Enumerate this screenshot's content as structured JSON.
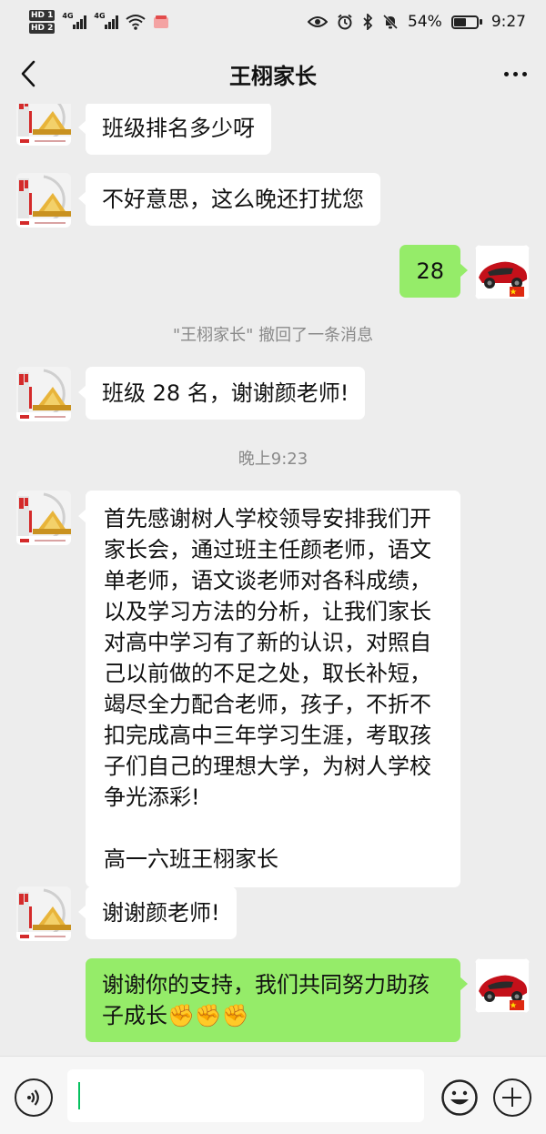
{
  "status_bar": {
    "hd1": "HD 1",
    "hd2": "HD 2",
    "net1": "4G",
    "net2": "4G",
    "battery_percent": "54%",
    "time": "9:27"
  },
  "header": {
    "title": "王栩家长"
  },
  "messages": {
    "m1": "班级排名多少呀",
    "m2": "不好意思，这么晚还打扰您",
    "m3": "28",
    "recall_notice": "\"王栩家长\" 撤回了一条消息",
    "m4": "班级 28 名，谢谢颜老师!",
    "timestamp": "晚上9:23",
    "m5": "首先感谢树人学校领导安排我们开家长会，通过班主任颜老师，语文单老师，语文谈老师对各科成绩，以及学习方法的分析，让我们家长对高中学习有了新的认识，对照自己以前做的不足之处，取长补短，竭尽全力配合老师，孩子，不折不扣完成高中三年学习生涯，考取孩子们自己的理想大学，为树人学校争光添彩!\n\n高一六班王栩家长",
    "m6": "谢谢颜老师!",
    "m7": "谢谢你的支持，我们共同努力助孩子成长✊✊✊"
  },
  "colors": {
    "background": "#ededed",
    "incoming_bubble": "#ffffff",
    "outgoing_bubble": "#95ec69",
    "system_text": "#8a8a8a"
  }
}
